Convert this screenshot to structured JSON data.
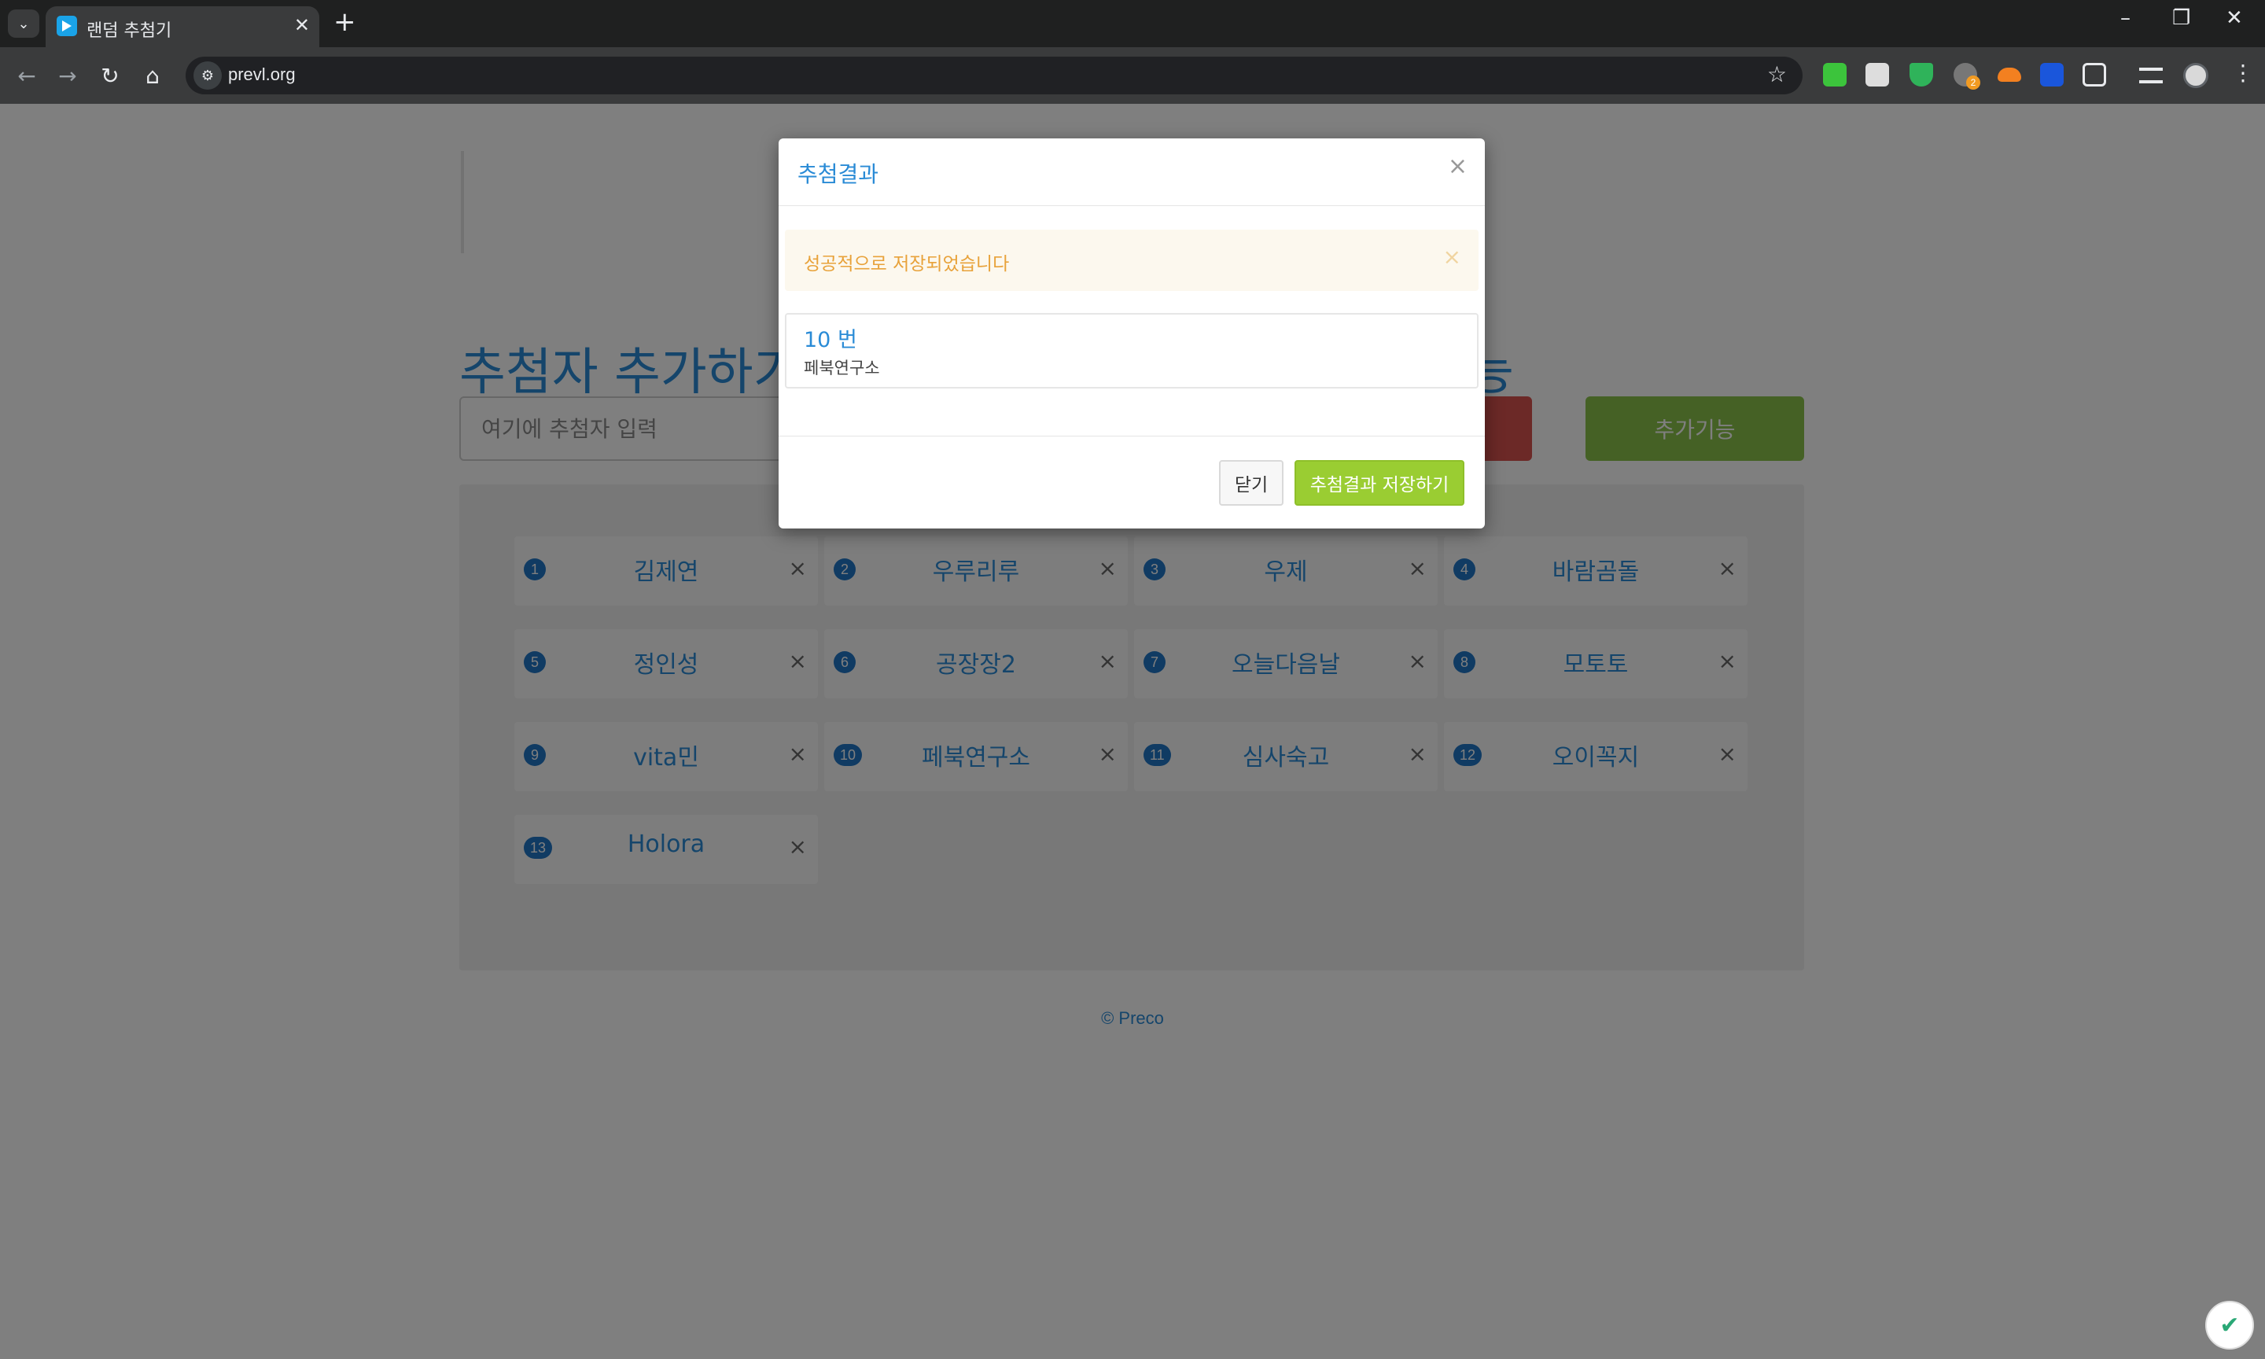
{
  "browser": {
    "tab_title": "랜덤 추첨기",
    "url": "prevl.org",
    "tab_menu_icon": "chevron-down-icon",
    "new_tab_symbol": "+",
    "close_symbol": "✕",
    "back_symbol": "←",
    "forward_symbol": "→",
    "reload_symbol": "↻",
    "home_symbol": "⌂",
    "star_symbol": "☆",
    "minimize_symbol": "–",
    "restore_symbol": "❐",
    "window_close_symbol": "✕",
    "site_info_symbol": "⚙",
    "menu_symbol": "⋮",
    "extension_badge": "2"
  },
  "page": {
    "heading": "추첨자 추가하기",
    "heading_tail": "능",
    "input_placeholder": "여기에 추첨자 입력",
    "extra_button": "추가기능",
    "remove_symbol": "×",
    "footer": "© Preco",
    "entries": [
      {
        "number": "1",
        "name": "김제연"
      },
      {
        "number": "2",
        "name": "우루리루"
      },
      {
        "number": "3",
        "name": "우제"
      },
      {
        "number": "4",
        "name": "바람곰돌"
      },
      {
        "number": "5",
        "name": "정인성"
      },
      {
        "number": "6",
        "name": "공장장2"
      },
      {
        "number": "7",
        "name": "오늘다음날"
      },
      {
        "number": "8",
        "name": "모토토"
      },
      {
        "number": "9",
        "name": "vita민"
      },
      {
        "number": "10",
        "name": "페북연구소"
      },
      {
        "number": "11",
        "name": "심사숙고"
      },
      {
        "number": "12",
        "name": "오이꼭지"
      },
      {
        "number": "13",
        "name": "Holora"
      }
    ]
  },
  "modal": {
    "title": "추첨결과",
    "close_symbol": "×",
    "alert_text": "성공적으로 저장되었습니다",
    "result_number": "10 번",
    "result_name": "페북연구소",
    "close_button": "닫기",
    "save_button": "추첨결과 저장하기"
  },
  "colors": {
    "accent": "#2a8bd6",
    "badge": "#2176c6",
    "save_button": "#9acd32",
    "alert_text": "#e8a23a"
  }
}
